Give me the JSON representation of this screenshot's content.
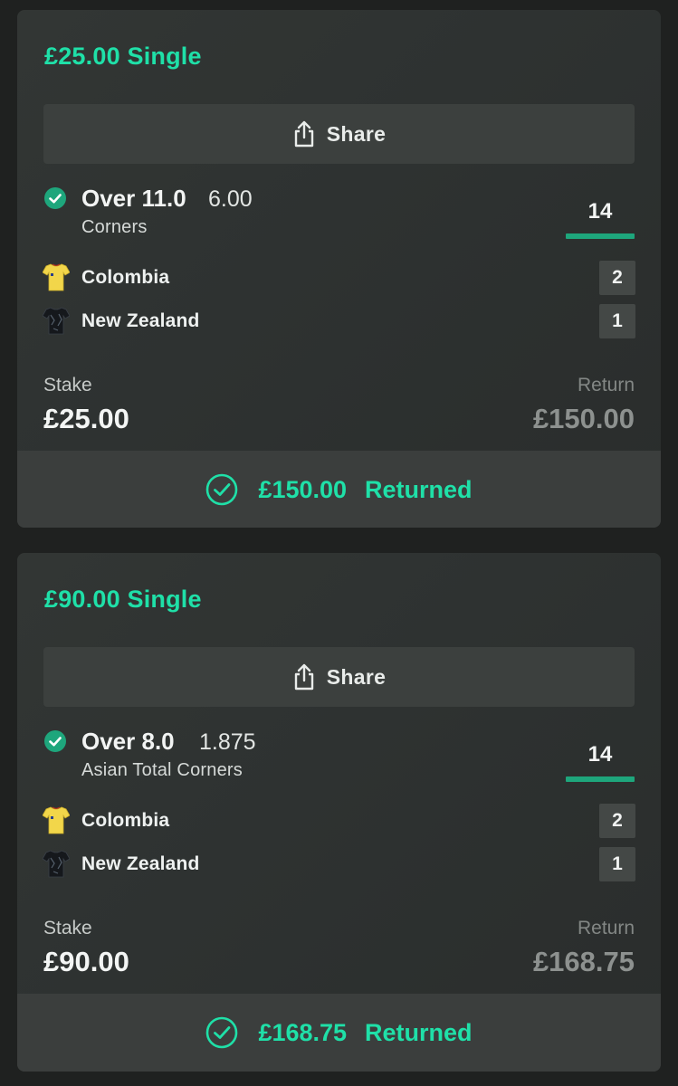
{
  "bets": [
    {
      "title": "£25.00 Single",
      "share_label": "Share",
      "selection": "Over 11.0",
      "odds": "6.00",
      "market": "Corners",
      "total": "14",
      "teams": [
        {
          "name": "Colombia",
          "score": "2",
          "shirt": "colombia-shirt-icon"
        },
        {
          "name": "New Zealand",
          "score": "1",
          "shirt": "new-zealand-shirt-icon"
        }
      ],
      "stake_label": "Stake",
      "stake": "£25.00",
      "return_label": "Return",
      "return": "£150.00",
      "returned_amount": "£150.00",
      "returned_label": "Returned"
    },
    {
      "title": "£90.00 Single",
      "share_label": "Share",
      "selection": "Over 8.0",
      "odds": "1.875",
      "market": "Asian Total Corners",
      "total": "14",
      "teams": [
        {
          "name": "Colombia",
          "score": "2",
          "shirt": "colombia-shirt-icon"
        },
        {
          "name": "New Zealand",
          "score": "1",
          "shirt": "new-zealand-shirt-icon"
        }
      ],
      "stake_label": "Stake",
      "stake": "£90.00",
      "return_label": "Return",
      "return": "£168.75",
      "returned_amount": "£168.75",
      "returned_label": "Returned"
    }
  ],
  "colors": {
    "accent": "#1fe0a8",
    "card_bg": "#2e3231",
    "share_bg": "#3c403e",
    "score_bar": "#1ea67c"
  }
}
